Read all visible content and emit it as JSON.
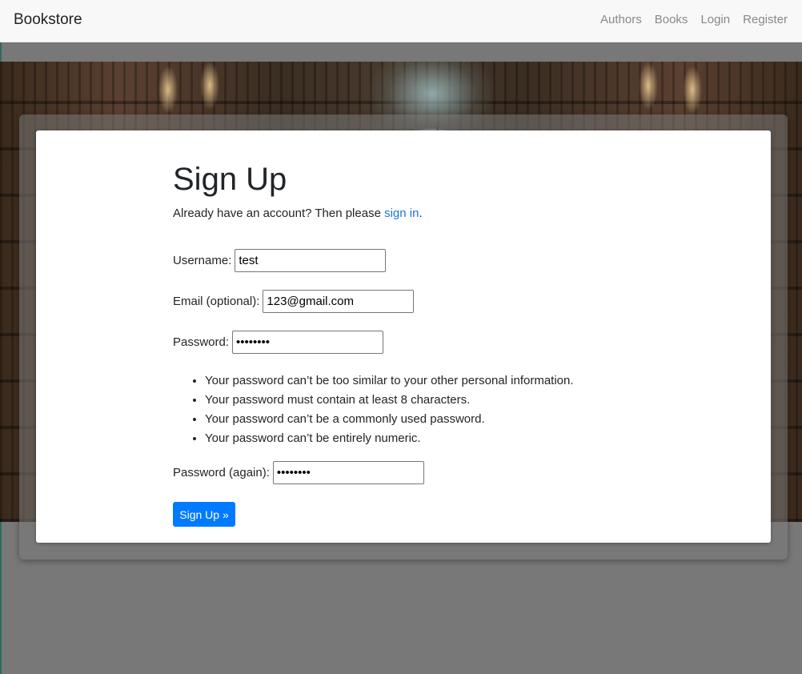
{
  "navbar": {
    "brand": "Bookstore",
    "links": [
      "Authors",
      "Books",
      "Login",
      "Register"
    ]
  },
  "form": {
    "title": "Sign Up",
    "intro_text": "Already have an account? Then please ",
    "intro_link": "sign in",
    "intro_end": ".",
    "username": {
      "label": "Username:",
      "value": "test"
    },
    "email": {
      "label": "Email (optional):",
      "value": "123@gmail.com"
    },
    "password": {
      "label": "Password:",
      "value": "testtest"
    },
    "password_help": [
      "Your password can’t be too similar to your other personal information.",
      "Your password must contain at least 8 characters.",
      "Your password can’t be a commonly used password.",
      "Your password can’t be entirely numeric."
    ],
    "password2": {
      "label": "Password (again):",
      "value": "testtest"
    },
    "submit_label": "Sign Up »"
  },
  "colors": {
    "accent": "#007bff",
    "link": "#1a73e8",
    "backdrop": "#787878"
  }
}
